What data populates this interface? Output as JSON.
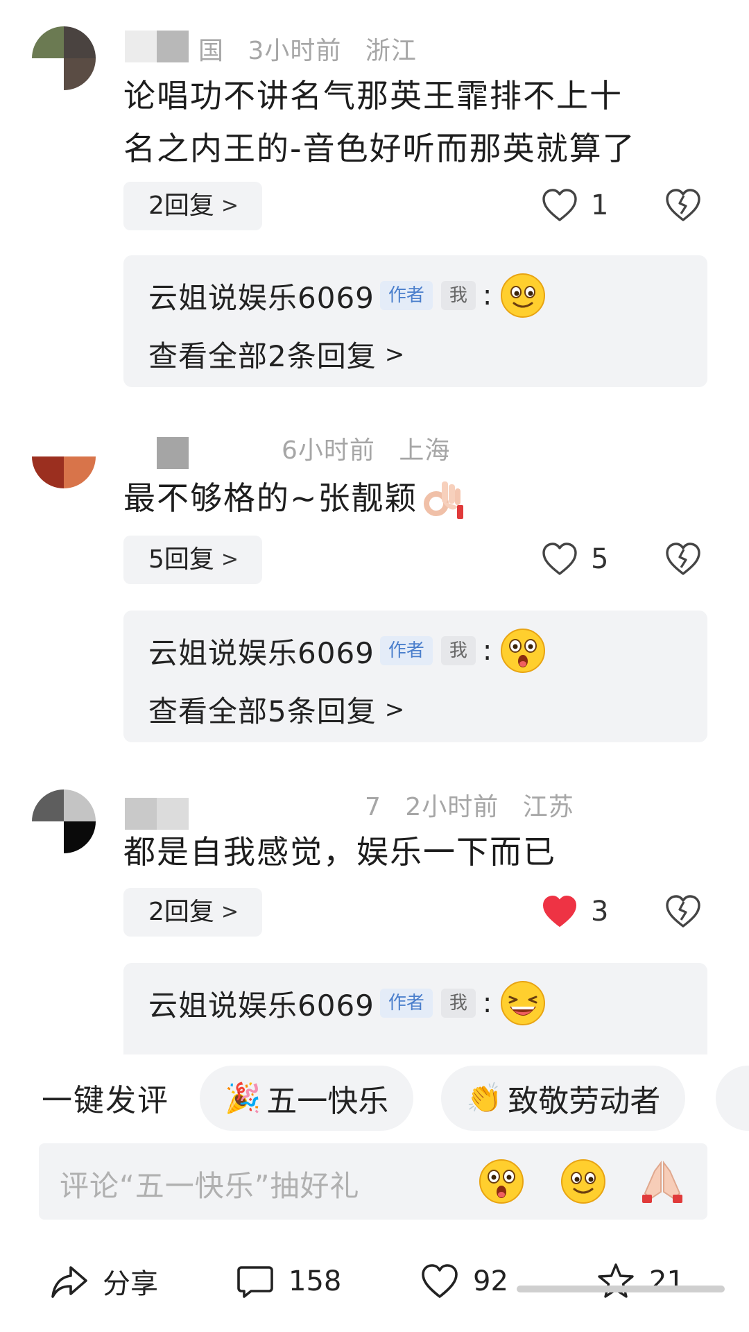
{
  "comments": [
    {
      "name_tail": "国",
      "time": "3小时前",
      "location": "浙江",
      "text_lines": [
        "论唱功不讲名气那英王霏排不上十",
        "名之内王的-音色好听而那英就算了"
      ],
      "reply_count_label": "2回复",
      "likes": "1",
      "liked": false,
      "sub_reply": {
        "author": "云姐说娱乐6069",
        "author_badge": "作者",
        "me_badge": "我",
        "colon": ":",
        "emoji": "smile-emoji",
        "view_all": "查看全部2条回复"
      }
    },
    {
      "name_tail": "",
      "time": "6小时前",
      "location": "上海",
      "text_lines": [
        "最不够格的~张靓颖"
      ],
      "text_emoji": "ok-hand-emoji",
      "reply_count_label": "5回复",
      "likes": "5",
      "liked": false,
      "sub_reply": {
        "author": "云姐说娱乐6069",
        "author_badge": "作者",
        "me_badge": "我",
        "colon": ":",
        "emoji": "surprised-emoji",
        "view_all": "查看全部5条回复"
      }
    },
    {
      "name_tail": "7",
      "time": "2小时前",
      "location": "江苏",
      "text_lines": [
        "都是自我感觉，娱乐一下而已"
      ],
      "reply_count_label": "2回复",
      "likes": "3",
      "liked": true,
      "sub_reply": {
        "author": "云姐说娱乐6069",
        "author_badge": "作者",
        "me_badge": "我",
        "colon": ":",
        "emoji": "laughing-emoji"
      }
    }
  ],
  "quick_comment": {
    "label": "一键发评",
    "chips": [
      {
        "icon": "party-popper-icon",
        "glyph": "🎉",
        "text": "五一快乐"
      },
      {
        "icon": "clapping-hands-icon",
        "glyph": "👏",
        "text": "致敬劳动者"
      }
    ]
  },
  "input": {
    "placeholder": "评论“五一快乐”抽好礼",
    "emojis": [
      "surprised-emoji",
      "smile-emoji",
      "praying-hands-emoji"
    ]
  },
  "bottom_bar": {
    "share_label": "分享",
    "comments_count": "158",
    "likes_count": "92",
    "favorites_count": "21"
  },
  "colors": {
    "liked_heart": "#ee3344",
    "badge_author": "#4b7fcc",
    "meta_gray": "#a6a6a6",
    "pill_bg": "#f2f3f5"
  }
}
